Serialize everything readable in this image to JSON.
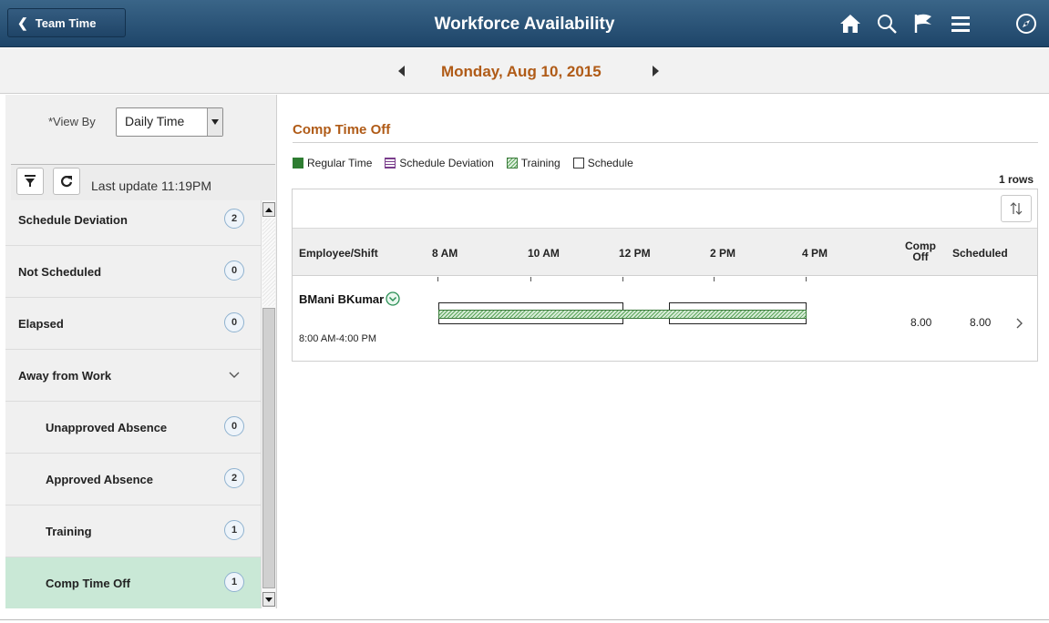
{
  "header": {
    "back_label": "Team Time",
    "title": "Workforce Availability",
    "icons": [
      "home-icon",
      "search-icon",
      "flag-icon",
      "menu-icon",
      "compass-icon"
    ]
  },
  "datebar": {
    "date": "Monday, Aug 10, 2015"
  },
  "left": {
    "viewby_label": "*View By",
    "viewby_value": "Daily Time",
    "last_update": "Last update 11:19PM",
    "items": [
      {
        "label": "Schedule Deviation",
        "count": "2"
      },
      {
        "label": "Not Scheduled",
        "count": "0"
      },
      {
        "label": "Elapsed",
        "count": "0"
      },
      {
        "label": "Away from Work"
      },
      {
        "label": "Unapproved Absence",
        "count": "0"
      },
      {
        "label": "Approved Absence",
        "count": "2"
      },
      {
        "label": "Training",
        "count": "1"
      },
      {
        "label": "Comp Time Off",
        "count": "1"
      }
    ]
  },
  "main": {
    "title": "Comp Time Off",
    "legend": [
      "Regular Time",
      "Schedule Deviation",
      "Training",
      "Schedule"
    ],
    "legend_colors": {
      "regular": "#2e7d32",
      "deviation": "#7a3d8c",
      "training": "#5aa55a"
    },
    "rows_count": "1 rows",
    "columns": {
      "employee": "Employee/Shift",
      "t8": "8 AM",
      "t10": "10 AM",
      "t12": "12 PM",
      "t2": "2 PM",
      "t4": "4 PM",
      "comp_line1": "Comp",
      "comp_line2": "Off",
      "scheduled": "Scheduled"
    },
    "row": {
      "name": "BMani BKumar",
      "shift": "8:00 AM-4:00 PM",
      "comp_off": "8.00",
      "scheduled": "8.00"
    }
  },
  "accent_color": "#b05b17"
}
